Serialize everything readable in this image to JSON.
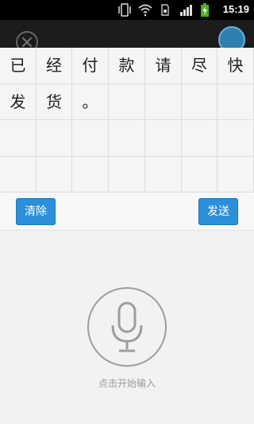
{
  "status_bar": {
    "time": "15:19"
  },
  "grid": {
    "rows": [
      [
        "已",
        "经",
        "付",
        "款",
        "请",
        "尽",
        "快"
      ],
      [
        "发",
        "货",
        "。",
        "",
        "",
        "",
        ""
      ],
      [
        "",
        "",
        "",
        "",
        "",
        "",
        ""
      ],
      [
        "",
        "",
        "",
        "",
        "",
        "",
        ""
      ]
    ]
  },
  "actions": {
    "clear_label": "清除",
    "send_label": "发送"
  },
  "voice": {
    "hint": "点击开始输入"
  },
  "colors": {
    "button_blue": "#2b8fd9",
    "mic_gray": "#9d9d9d"
  }
}
